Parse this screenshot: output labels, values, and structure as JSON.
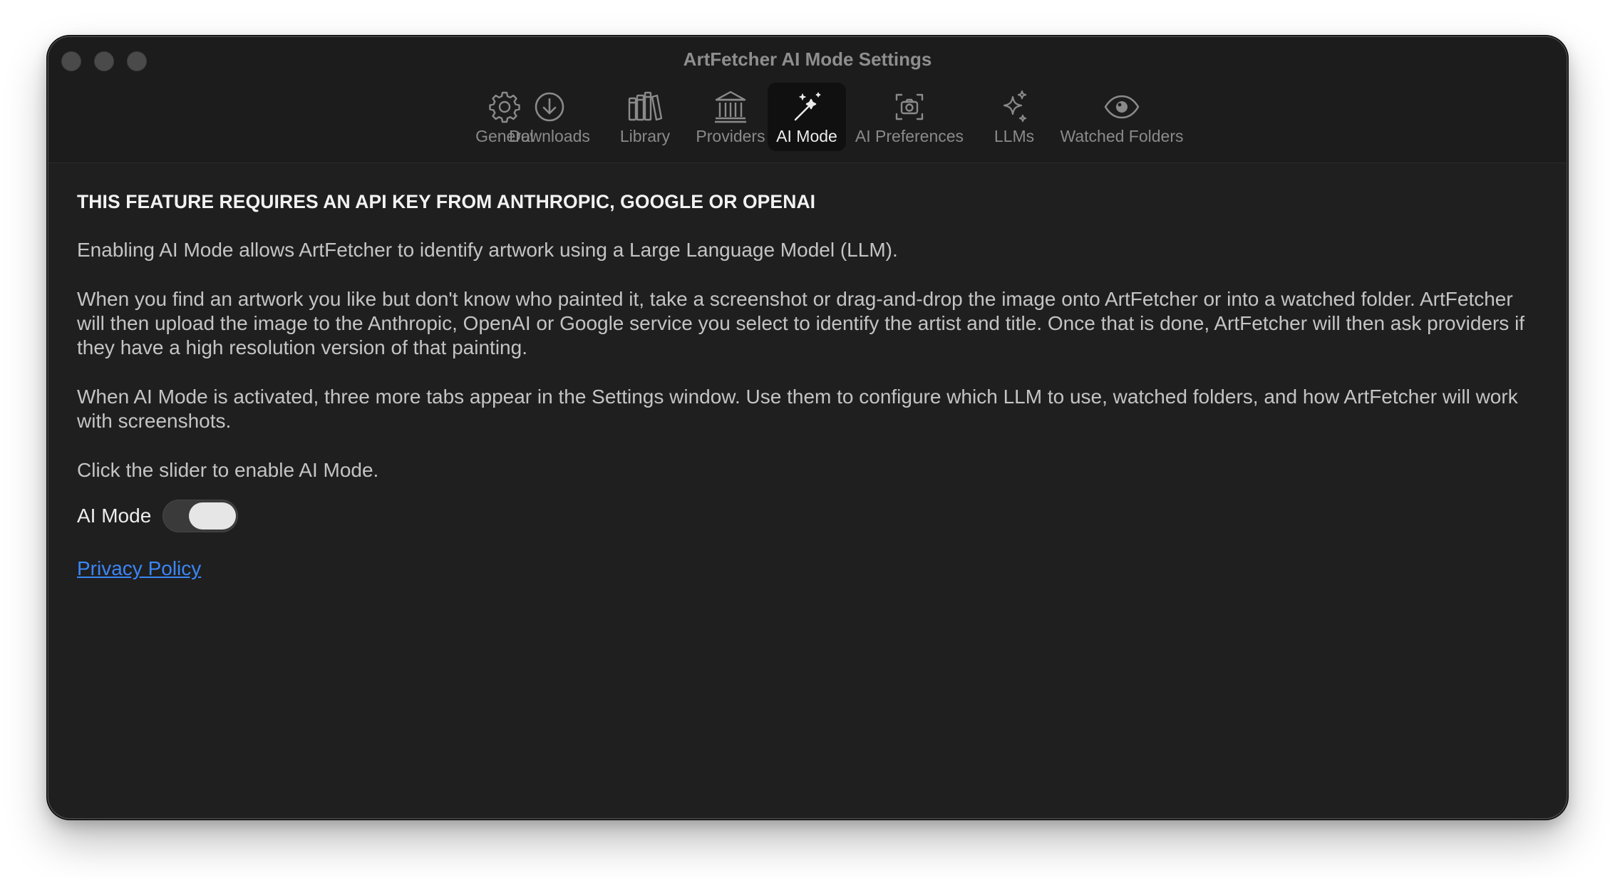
{
  "window": {
    "title": "ArtFetcher AI Mode Settings"
  },
  "tabs": [
    {
      "label": "General",
      "icon": "gear-icon",
      "active": false
    },
    {
      "label": "Downloads",
      "icon": "download-icon",
      "active": false
    },
    {
      "label": "Library",
      "icon": "books-icon",
      "active": false
    },
    {
      "label": "Providers",
      "icon": "bank-icon",
      "active": false
    },
    {
      "label": "AI Mode",
      "icon": "magic-wand-icon",
      "active": true
    },
    {
      "label": "AI Preferences",
      "icon": "camera-viewfinder-icon",
      "active": false
    },
    {
      "label": "LLMs",
      "icon": "sparkles-icon",
      "active": false
    },
    {
      "label": "Watched Folders",
      "icon": "eye-icon",
      "active": false
    }
  ],
  "content": {
    "headline": "THIS FEATURE REQUIRES AN API KEY FROM ANTHROPIC, GOOGLE OR OPENAI",
    "para1": "Enabling AI Mode allows ArtFetcher to identify artwork using a Large Language Model (LLM).",
    "para2": "When you find an artwork you like but don't know who painted it, take a screenshot or drag-and-drop the image onto ArtFetcher or into a watched folder. ArtFetcher will then upload the image to the Anthropic, OpenAI or Google service you select to identify the artist and title. Once that is done, ArtFetcher will then ask providers if they have a high resolution version of that painting.",
    "para3": "When AI Mode is activated, three more tabs appear in the Settings window. Use them to configure which LLM to use, watched folders, and how ArtFetcher will work with screenshots.",
    "para4": "Click the slider to enable AI Mode.",
    "toggle_label": "AI Mode",
    "toggle_on": true,
    "privacy_link": "Privacy Policy"
  },
  "colors": {
    "window_bg": "#1f1f1f",
    "link": "#3b86f7",
    "active_tab_bg": "#101010"
  }
}
